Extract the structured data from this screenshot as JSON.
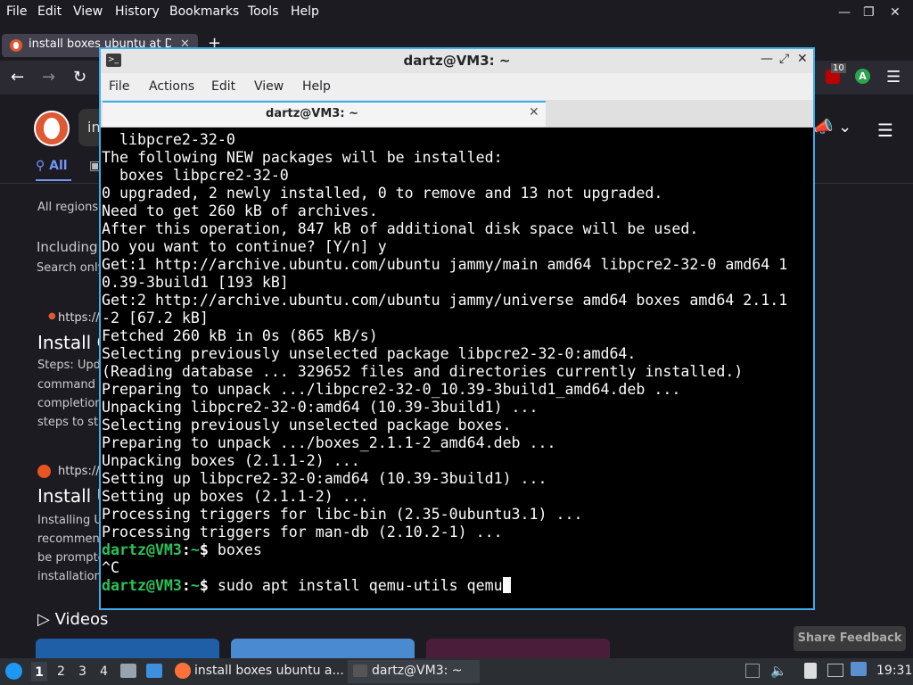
{
  "firefox": {
    "menu": [
      "File",
      "Edit",
      "View",
      "History",
      "Bookmarks",
      "Tools",
      "Help"
    ],
    "tab_title": "install boxes ubuntu at D",
    "new_tab": "+",
    "badge_count": "10",
    "account_initial": "A"
  },
  "ddg": {
    "search_partial": "in",
    "tab_all": "All",
    "filter_region": "All regions",
    "including": "Including r",
    "search_only": "Search only",
    "result1_url": "https://",
    "result1_title": "Install G",
    "result1_snippet": [
      "Steps: Upd",
      "command f",
      "completion",
      "steps to sta"
    ],
    "result2_url": "https://",
    "result2_title": "Install U",
    "result2_snippet": [
      "Installing U",
      "recommen",
      "be prompte",
      "installation"
    ],
    "videos": "Videos",
    "share_feedback": "Share Feedback"
  },
  "terminal": {
    "window_title": "dartz@VM3: ~",
    "menu": [
      "File",
      "Actions",
      "Edit",
      "View",
      "Help"
    ],
    "tab_title": "dartz@VM3: ~",
    "lines": [
      "  libpcre2-32-0",
      "The following NEW packages will be installed:",
      "  boxes libpcre2-32-0",
      "0 upgraded, 2 newly installed, 0 to remove and 13 not upgraded.",
      "Need to get 260 kB of archives.",
      "After this operation, 847 kB of additional disk space will be used.",
      "Do you want to continue? [Y/n] y",
      "Get:1 http://archive.ubuntu.com/ubuntu jammy/main amd64 libpcre2-32-0 amd64 1",
      "0.39-3build1 [193 kB]",
      "Get:2 http://archive.ubuntu.com/ubuntu jammy/universe amd64 boxes amd64 2.1.1",
      "-2 [67.2 kB]",
      "Fetched 260 kB in 0s (865 kB/s)",
      "Selecting previously unselected package libpcre2-32-0:amd64.",
      "(Reading database ... 329652 files and directories currently installed.)",
      "Preparing to unpack .../libpcre2-32-0_10.39-3build1_amd64.deb ...",
      "Unpacking libpcre2-32-0:amd64 (10.39-3build1) ...",
      "Selecting previously unselected package boxes.",
      "Preparing to unpack .../boxes_2.1.1-2_amd64.deb ...",
      "Unpacking boxes (2.1.1-2) ...",
      "Setting up libpcre2-32-0:amd64 (10.39-3build1) ...",
      "Setting up boxes (2.1.1-2) ...",
      "Processing triggers for libc-bin (2.35-0ubuntu3.1) ...",
      "Processing triggers for man-db (2.10.2-1) ..."
    ],
    "prompt_user": "dartz@VM3",
    "prompt_sep": ":",
    "prompt_path": "~",
    "prompt_dollar": "$ ",
    "cmd1": "boxes",
    "ctrl_c": "^C",
    "cmd2": "sudo apt install qemu-utils qemu"
  },
  "taskbar": {
    "workspaces": [
      "1",
      "2",
      "3",
      "4"
    ],
    "firefox_task": "install boxes ubuntu a...",
    "terminal_task": "dartz@VM3: ~",
    "clock": "19:31"
  }
}
